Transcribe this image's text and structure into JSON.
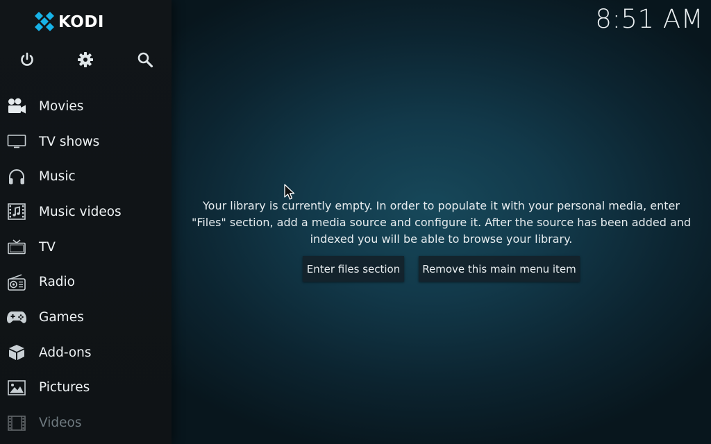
{
  "app": {
    "logo_text": "KODI",
    "clock": "8:51 AM"
  },
  "top_icons": {
    "power": "power-icon",
    "settings": "gear-icon",
    "search": "search-icon"
  },
  "menu": {
    "items": [
      {
        "label": "Movies",
        "icon": "movies-icon"
      },
      {
        "label": "TV shows",
        "icon": "tv-shows-icon"
      },
      {
        "label": "Music",
        "icon": "headphones-icon"
      },
      {
        "label": "Music videos",
        "icon": "music-videos-icon"
      },
      {
        "label": "TV",
        "icon": "tv-icon"
      },
      {
        "label": "Radio",
        "icon": "radio-icon"
      },
      {
        "label": "Games",
        "icon": "gamepad-icon"
      },
      {
        "label": "Add-ons",
        "icon": "addons-box-icon"
      },
      {
        "label": "Pictures",
        "icon": "pictures-icon"
      },
      {
        "label": "Videos",
        "icon": "videos-film-icon"
      }
    ]
  },
  "main": {
    "message_lines": [
      "Your library is currently empty. In order to populate it with your personal media, enter",
      "\"Files\" section, add a media source and configure it. After the source has been added and",
      "indexed you will be able to browse your library."
    ],
    "enter_files_label": "Enter files section",
    "remove_item_label": "Remove this main menu item"
  },
  "colors": {
    "accent": "#17b2e7",
    "sidebar_bg": "#111518",
    "text": "#eef2f4"
  }
}
